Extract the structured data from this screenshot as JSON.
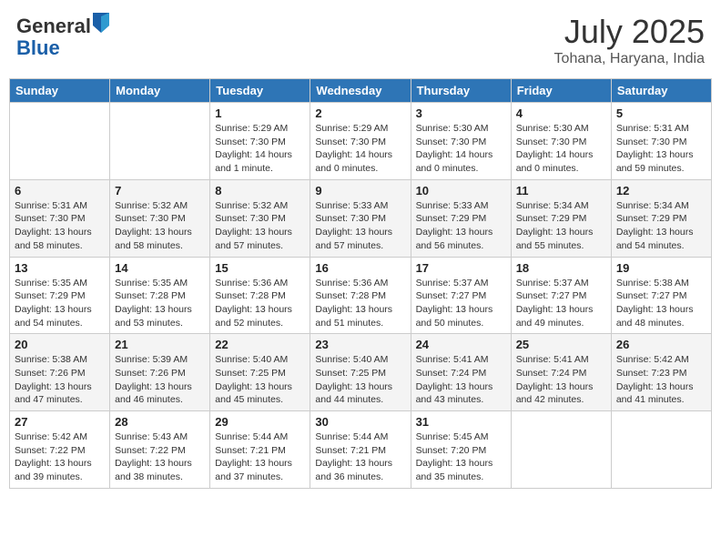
{
  "header": {
    "logo_general": "General",
    "logo_blue": "Blue",
    "month_title": "July 2025",
    "location": "Tohana, Haryana, India"
  },
  "weekdays": [
    "Sunday",
    "Monday",
    "Tuesday",
    "Wednesday",
    "Thursday",
    "Friday",
    "Saturday"
  ],
  "weeks": [
    [
      {
        "day": "",
        "info": ""
      },
      {
        "day": "",
        "info": ""
      },
      {
        "day": "1",
        "info": "Sunrise: 5:29 AM\nSunset: 7:30 PM\nDaylight: 14 hours and 1 minute."
      },
      {
        "day": "2",
        "info": "Sunrise: 5:29 AM\nSunset: 7:30 PM\nDaylight: 14 hours and 0 minutes."
      },
      {
        "day": "3",
        "info": "Sunrise: 5:30 AM\nSunset: 7:30 PM\nDaylight: 14 hours and 0 minutes."
      },
      {
        "day": "4",
        "info": "Sunrise: 5:30 AM\nSunset: 7:30 PM\nDaylight: 14 hours and 0 minutes."
      },
      {
        "day": "5",
        "info": "Sunrise: 5:31 AM\nSunset: 7:30 PM\nDaylight: 13 hours and 59 minutes."
      }
    ],
    [
      {
        "day": "6",
        "info": "Sunrise: 5:31 AM\nSunset: 7:30 PM\nDaylight: 13 hours and 58 minutes."
      },
      {
        "day": "7",
        "info": "Sunrise: 5:32 AM\nSunset: 7:30 PM\nDaylight: 13 hours and 58 minutes."
      },
      {
        "day": "8",
        "info": "Sunrise: 5:32 AM\nSunset: 7:30 PM\nDaylight: 13 hours and 57 minutes."
      },
      {
        "day": "9",
        "info": "Sunrise: 5:33 AM\nSunset: 7:30 PM\nDaylight: 13 hours and 57 minutes."
      },
      {
        "day": "10",
        "info": "Sunrise: 5:33 AM\nSunset: 7:29 PM\nDaylight: 13 hours and 56 minutes."
      },
      {
        "day": "11",
        "info": "Sunrise: 5:34 AM\nSunset: 7:29 PM\nDaylight: 13 hours and 55 minutes."
      },
      {
        "day": "12",
        "info": "Sunrise: 5:34 AM\nSunset: 7:29 PM\nDaylight: 13 hours and 54 minutes."
      }
    ],
    [
      {
        "day": "13",
        "info": "Sunrise: 5:35 AM\nSunset: 7:29 PM\nDaylight: 13 hours and 54 minutes."
      },
      {
        "day": "14",
        "info": "Sunrise: 5:35 AM\nSunset: 7:28 PM\nDaylight: 13 hours and 53 minutes."
      },
      {
        "day": "15",
        "info": "Sunrise: 5:36 AM\nSunset: 7:28 PM\nDaylight: 13 hours and 52 minutes."
      },
      {
        "day": "16",
        "info": "Sunrise: 5:36 AM\nSunset: 7:28 PM\nDaylight: 13 hours and 51 minutes."
      },
      {
        "day": "17",
        "info": "Sunrise: 5:37 AM\nSunset: 7:27 PM\nDaylight: 13 hours and 50 minutes."
      },
      {
        "day": "18",
        "info": "Sunrise: 5:37 AM\nSunset: 7:27 PM\nDaylight: 13 hours and 49 minutes."
      },
      {
        "day": "19",
        "info": "Sunrise: 5:38 AM\nSunset: 7:27 PM\nDaylight: 13 hours and 48 minutes."
      }
    ],
    [
      {
        "day": "20",
        "info": "Sunrise: 5:38 AM\nSunset: 7:26 PM\nDaylight: 13 hours and 47 minutes."
      },
      {
        "day": "21",
        "info": "Sunrise: 5:39 AM\nSunset: 7:26 PM\nDaylight: 13 hours and 46 minutes."
      },
      {
        "day": "22",
        "info": "Sunrise: 5:40 AM\nSunset: 7:25 PM\nDaylight: 13 hours and 45 minutes."
      },
      {
        "day": "23",
        "info": "Sunrise: 5:40 AM\nSunset: 7:25 PM\nDaylight: 13 hours and 44 minutes."
      },
      {
        "day": "24",
        "info": "Sunrise: 5:41 AM\nSunset: 7:24 PM\nDaylight: 13 hours and 43 minutes."
      },
      {
        "day": "25",
        "info": "Sunrise: 5:41 AM\nSunset: 7:24 PM\nDaylight: 13 hours and 42 minutes."
      },
      {
        "day": "26",
        "info": "Sunrise: 5:42 AM\nSunset: 7:23 PM\nDaylight: 13 hours and 41 minutes."
      }
    ],
    [
      {
        "day": "27",
        "info": "Sunrise: 5:42 AM\nSunset: 7:22 PM\nDaylight: 13 hours and 39 minutes."
      },
      {
        "day": "28",
        "info": "Sunrise: 5:43 AM\nSunset: 7:22 PM\nDaylight: 13 hours and 38 minutes."
      },
      {
        "day": "29",
        "info": "Sunrise: 5:44 AM\nSunset: 7:21 PM\nDaylight: 13 hours and 37 minutes."
      },
      {
        "day": "30",
        "info": "Sunrise: 5:44 AM\nSunset: 7:21 PM\nDaylight: 13 hours and 36 minutes."
      },
      {
        "day": "31",
        "info": "Sunrise: 5:45 AM\nSunset: 7:20 PM\nDaylight: 13 hours and 35 minutes."
      },
      {
        "day": "",
        "info": ""
      },
      {
        "day": "",
        "info": ""
      }
    ]
  ]
}
